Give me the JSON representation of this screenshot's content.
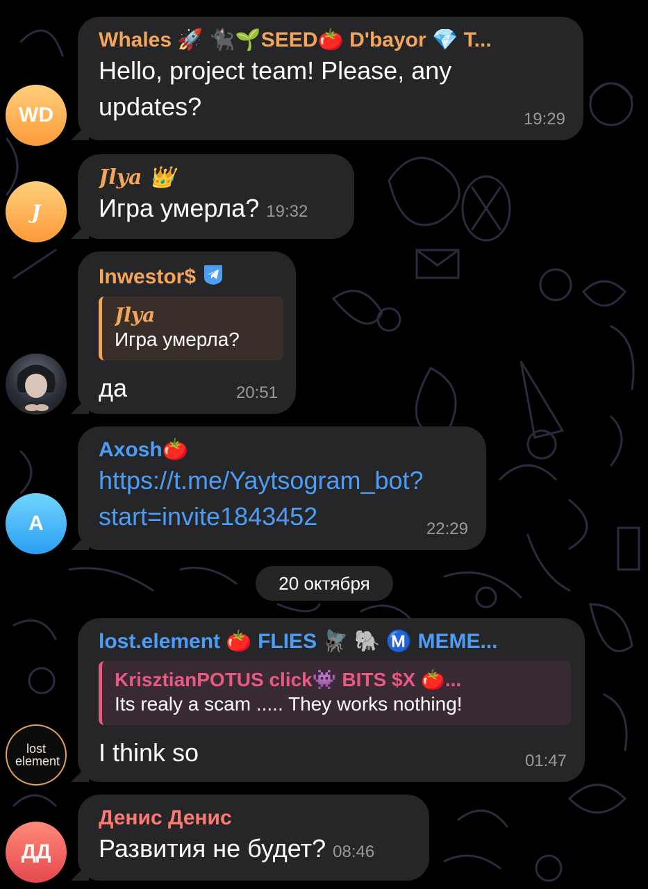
{
  "colors": {
    "bubble": "#262628",
    "name_orange": "#f3a55a",
    "name_blue": "#4c9df5",
    "name_pink": "#e85a82",
    "name_red": "#ff7a72",
    "link": "#4c9df5",
    "time": "#9a9a9d"
  },
  "messages": [
    {
      "avatar": "WD",
      "sender": "Whales 🚀 🐈‍⬛🌱SEED🍅 D'bayor 💎 T...",
      "text": "Hello, project team! Please, any updates?",
      "time": "19:29"
    },
    {
      "avatar": "J",
      "sender": "Jlya 👑",
      "text": "Игра умерла?",
      "time": "19:32"
    },
    {
      "avatar": "anime-portrait",
      "sender": "Inwestor$ ",
      "reply_name": "Jlya",
      "reply_text": "Игра умерла?",
      "text": "да",
      "time": "20:51"
    },
    {
      "avatar": "A",
      "sender": "Axosh🍅",
      "text_line1": "https://t.me/Yaytsogram_bot?",
      "text_line2": "start=invite1843452",
      "time": "22:29"
    },
    {
      "avatar": "lost element",
      "sender": "lost.element 🍅 FLIES 🪰 🐘 Ⓜ️ MEME...",
      "reply_name": "KrisztianPOTUS click👾 BITS $X 🍅...",
      "reply_text": "Its realy a scam ..... They works nothing!",
      "text": "I think so",
      "time": "01:47"
    },
    {
      "avatar": "ДД",
      "sender": "Денис Денис",
      "text": "Развития не будет?",
      "time": "08:46"
    }
  ],
  "date_separator": "20 октября"
}
